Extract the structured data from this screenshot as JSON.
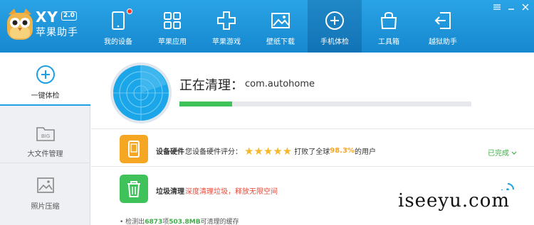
{
  "app": {
    "name_en": "XY",
    "version": "2.0",
    "name_cn": "苹果助手"
  },
  "nav": [
    {
      "label": "我的设备",
      "icon": "tablet-icon",
      "badge": true
    },
    {
      "label": "苹果应用",
      "icon": "apps-grid-icon"
    },
    {
      "label": "苹果游戏",
      "icon": "gamepad-icon"
    },
    {
      "label": "壁纸下载",
      "icon": "picture-icon"
    },
    {
      "label": "手机体检",
      "icon": "plus-circle-icon",
      "active": true
    },
    {
      "label": "工具箱",
      "icon": "toolbox-icon"
    },
    {
      "label": "越狱助手",
      "icon": "exit-icon"
    }
  ],
  "sidebar": [
    {
      "label": "一键体检",
      "icon": "plus-circle-icon",
      "active": true
    },
    {
      "label": "大文件管理",
      "icon": "folder-big-icon",
      "icon_text": "BIG"
    },
    {
      "label": "照片压缩",
      "icon": "photo-icon"
    }
  ],
  "scan": {
    "title": "正在清理：",
    "target": "com.autohome",
    "progress": 0.18
  },
  "rows": [
    {
      "name": "设备硬件",
      "desc_prefix": "您设备硬件评分：",
      "stars": "★★★★★",
      "desc_mid": " 打败了全球",
      "percent": "98.3%",
      "desc_suffix": "的用户",
      "status": "已完成",
      "icon_color": "#f5a623"
    },
    {
      "name": "垃圾清理",
      "desc": "深度清理垃圾，释放无限空间",
      "icon_color": "#3fc25a"
    }
  ],
  "bottom": {
    "prefix": "检测出",
    "count": "6873",
    "mid": "项",
    "size": "503.8MB",
    "suffix": "可清理的缓存"
  },
  "watermark": "iseeyu.com",
  "colors": {
    "topbar": "#1e96dc",
    "accent": "#1ea0e6",
    "progress": "#3fc25a",
    "stars": "#f5b82a"
  }
}
